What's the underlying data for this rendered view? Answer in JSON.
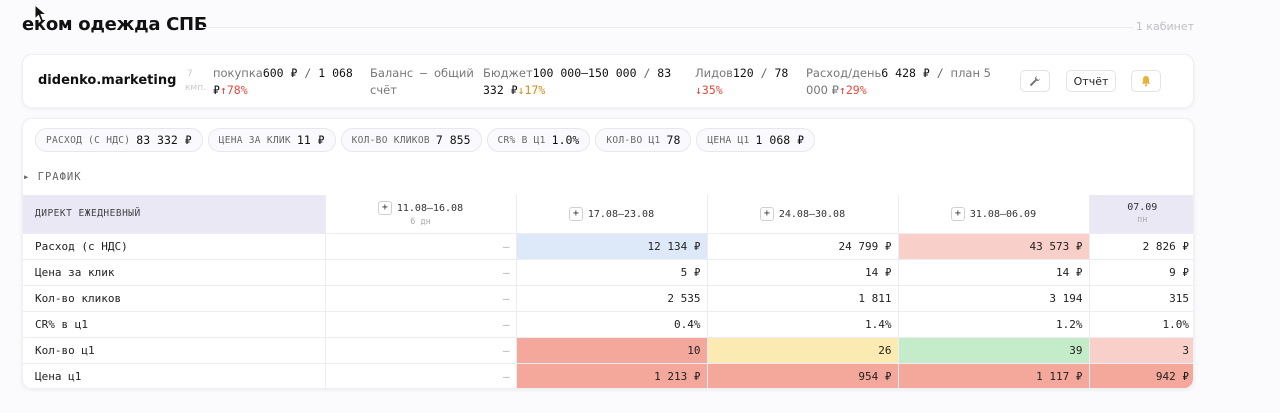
{
  "header": {
    "title": "еком одежда СПБ",
    "cabinet": "1 кабинет"
  },
  "card": {
    "brand": "didenko.marketing",
    "campaigns": [
      "7",
      "кмп."
    ],
    "purchase": {
      "label": "покупка",
      "value": "600 ₽",
      "sep": " / ",
      "plan": "1 068",
      "cur": "₽",
      "delta": "↑78%"
    },
    "balance": {
      "label": "Баланс",
      "sep": " — ",
      "value": "общий",
      "line2": "счёт"
    },
    "budget": {
      "label": "Бюджет",
      "value": "100 000–150 000",
      "sep": " / ",
      "plan": "83",
      "line2": "332 ₽",
      "delta": "↓17%"
    },
    "leads": {
      "label": "Лидов",
      "value": "120",
      "sep": " / ",
      "plan": "78",
      "delta": "↓35%"
    },
    "spend_day": {
      "label": "Расход/день",
      "value": "6 428 ₽",
      "sep": " / ",
      "plan": "план 5",
      "line2": "000 ₽",
      "delta": "↑29%"
    },
    "buttons": {
      "wrench": "wrench-icon",
      "report": "Отчёт",
      "bell": "bell-icon"
    }
  },
  "chips": [
    {
      "label": "РАСХОД (С НДС)",
      "value": "83 332 ₽"
    },
    {
      "label": "ЦЕНА ЗА КЛИК",
      "value": "11 ₽"
    },
    {
      "label": "КОЛ-ВО КЛИКОВ",
      "value": "7 855"
    },
    {
      "label": "CR% В Ц1",
      "value": "1.0%"
    },
    {
      "label": "КОЛ-ВО Ц1",
      "value": "78"
    },
    {
      "label": "ЦЕНА Ц1",
      "value": "1 068 ₽"
    }
  ],
  "chart_toggle": "▸ ГРАФИК",
  "table": {
    "row_header": "ДИРЕКТ ЕЖЕДНЕВНЫЙ",
    "columns": [
      {
        "label": "11.08–16.08",
        "sub": "6 дн"
      },
      {
        "label": "17.08–23.08",
        "sub": ""
      },
      {
        "label": "24.08–30.08",
        "sub": ""
      },
      {
        "label": "31.08–06.09",
        "sub": ""
      },
      {
        "label": "07.09",
        "sub": "пн"
      }
    ],
    "rows": [
      {
        "name": "Расход (с НДС)",
        "cells": [
          "—",
          "12 134 ₽",
          "24 799 ₽",
          "43 573 ₽",
          "2 826 ₽"
        ]
      },
      {
        "name": "Цена за клик",
        "cells": [
          "—",
          "5 ₽",
          "14 ₽",
          "14 ₽",
          "9 ₽"
        ]
      },
      {
        "name": "Кол-во кликов",
        "cells": [
          "—",
          "2 535",
          "1 811",
          "3 194",
          "315"
        ]
      },
      {
        "name": "CR% в ц1",
        "cells": [
          "—",
          "0.4%",
          "1.4%",
          "1.2%",
          "1.0%"
        ]
      },
      {
        "name": "Кол-во ц1",
        "cells": [
          "—",
          "10",
          "26",
          "39",
          "3"
        ]
      },
      {
        "name": "Цена ц1",
        "cells": [
          "—",
          "1 213 ₽",
          "954 ₽",
          "1 117 ₽",
          "942 ₽"
        ]
      }
    ]
  },
  "colors": {
    "blue": "#dde8f8",
    "red_light": "#f9d0c9",
    "red": "#f4a89b",
    "yellow": "#fbeab1",
    "green": "#c5ecc9",
    "delta_red": "#e04b3b",
    "delta_orange": "#d58a1a"
  }
}
